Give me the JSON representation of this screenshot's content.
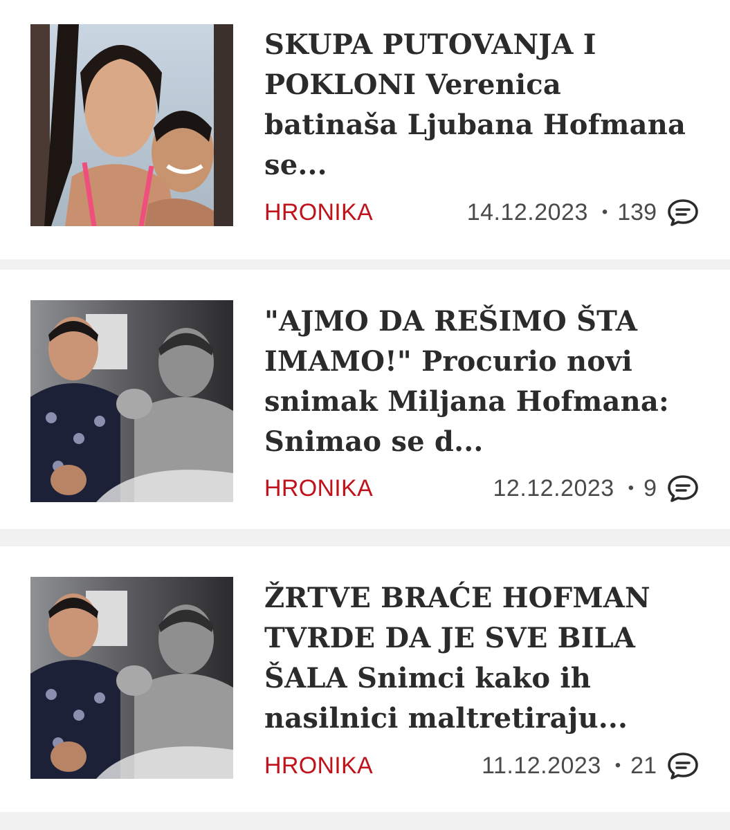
{
  "articles": [
    {
      "title": "SKUPA PUTOVANJA I POKLONI Verenica batinaša Ljubana Hofmana se...",
      "category": "HRONIKA",
      "date": "14.12.2023",
      "separator": "•",
      "comments": "139",
      "image_icon": "photo-icon",
      "comment_icon": "comment-bubble-icon"
    },
    {
      "title": "\"AJMO DA REŠIMO ŠTA IMAMO!\" Procurio novi snimak Miljana Hofmana: Snimao se d...",
      "category": "HRONIKA",
      "date": "12.12.2023",
      "separator": "•",
      "comments": "9",
      "image_icon": "photo-icon",
      "comment_icon": "comment-bubble-icon"
    },
    {
      "title": "ŽRTVE BRAĆE HOFMAN TVRDE DA JE SVE BILA ŠALA Snimci kako ih nasilnici maltretiraju...",
      "category": "HRONIKA",
      "date": "11.12.2023",
      "separator": "•",
      "comments": "21",
      "image_icon": "photo-icon",
      "comment_icon": "comment-bubble-icon"
    }
  ],
  "colors": {
    "category": "#c0121a",
    "title": "#2b2b2b",
    "meta": "#4a4a4a",
    "separator_band": "#f1f1f1"
  }
}
